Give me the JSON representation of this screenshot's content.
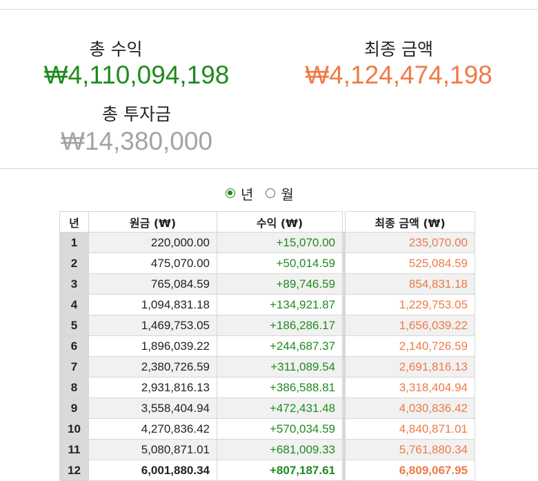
{
  "summary": {
    "total_profit_label": "총 수익",
    "total_profit_value": "₩4,110,094,198",
    "final_amount_label": "최종 금액",
    "final_amount_value": "₩4,124,474,198",
    "total_investment_label": "총 투자금",
    "total_investment_value": "₩14,380,000"
  },
  "period_toggle": {
    "options": [
      {
        "label": "년",
        "selected": true
      },
      {
        "label": "월",
        "selected": false
      }
    ]
  },
  "table": {
    "headers": {
      "year": "년",
      "principal": "원금 (₩)",
      "profit": "수익 (₩)",
      "final": "최종 금액 (₩)"
    },
    "rows": [
      {
        "year": "1",
        "principal": "220,000.00",
        "profit": "+15,070.00",
        "final": "235,070.00"
      },
      {
        "year": "2",
        "principal": "475,070.00",
        "profit": "+50,014.59",
        "final": "525,084.59"
      },
      {
        "year": "3",
        "principal": "765,084.59",
        "profit": "+89,746.59",
        "final": "854,831.18"
      },
      {
        "year": "4",
        "principal": "1,094,831.18",
        "profit": "+134,921.87",
        "final": "1,229,753.05"
      },
      {
        "year": "5",
        "principal": "1,469,753.05",
        "profit": "+186,286.17",
        "final": "1,656,039.22"
      },
      {
        "year": "6",
        "principal": "1,896,039.22",
        "profit": "+244,687.37",
        "final": "2,140,726.59"
      },
      {
        "year": "7",
        "principal": "2,380,726.59",
        "profit": "+311,089.54",
        "final": "2,691,816.13"
      },
      {
        "year": "8",
        "principal": "2,931,816.13",
        "profit": "+386,588.81",
        "final": "3,318,404.94"
      },
      {
        "year": "9",
        "principal": "3,558,404.94",
        "profit": "+472,431.48",
        "final": "4,030,836.42"
      },
      {
        "year": "10",
        "principal": "4,270,836.42",
        "profit": "+570,034.59",
        "final": "4,840,871.01"
      },
      {
        "year": "11",
        "principal": "5,080,871.01",
        "profit": "+681,009.33",
        "final": "5,761,880.34"
      },
      {
        "year": "12",
        "principal": "6,001,880.34",
        "profit": "+807,187.61",
        "final": "6,809,067.95"
      }
    ]
  },
  "colors": {
    "profit": "#1e8a1e",
    "final": "#ef7a46",
    "investment": "#a3a3a3"
  }
}
